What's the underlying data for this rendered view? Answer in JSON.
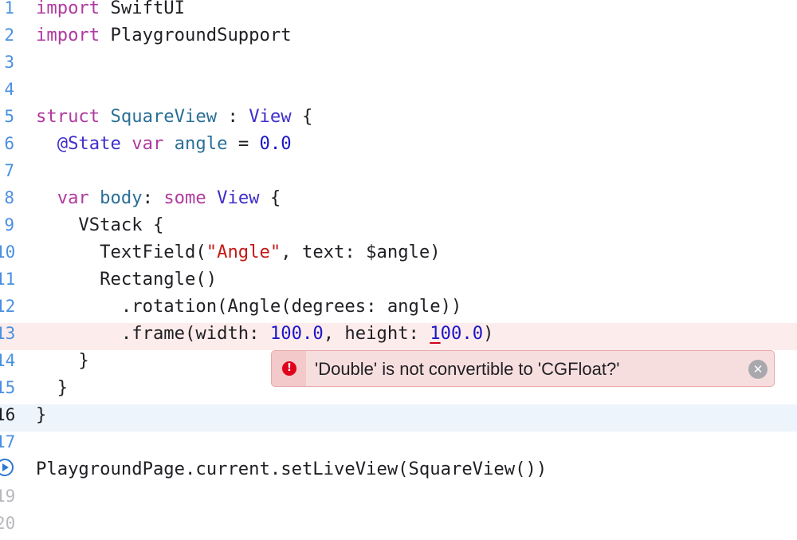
{
  "editor": {
    "lines": [
      {
        "n": "1",
        "parts": [
          {
            "t": "import",
            "c": "kw"
          },
          {
            "t": " SwiftUI",
            "c": ""
          }
        ]
      },
      {
        "n": "2",
        "parts": [
          {
            "t": "import",
            "c": "kw"
          },
          {
            "t": " PlaygroundSupport",
            "c": ""
          }
        ]
      },
      {
        "n": "3",
        "parts": []
      },
      {
        "n": "4",
        "parts": []
      },
      {
        "n": "5",
        "parts": [
          {
            "t": "struct",
            "c": "kw"
          },
          {
            "t": " ",
            "c": ""
          },
          {
            "t": "SquareView",
            "c": "pty"
          },
          {
            "t": " : ",
            "c": ""
          },
          {
            "t": "View",
            "c": "ty"
          },
          {
            "t": " {",
            "c": ""
          }
        ]
      },
      {
        "n": "6",
        "parts": [
          {
            "t": "  @State",
            "c": "ty"
          },
          {
            "t": " ",
            "c": ""
          },
          {
            "t": "var",
            "c": "kw"
          },
          {
            "t": " ",
            "c": ""
          },
          {
            "t": "angle",
            "c": "pty"
          },
          {
            "t": " = ",
            "c": ""
          },
          {
            "t": "0.0",
            "c": "num"
          }
        ]
      },
      {
        "n": "7",
        "parts": []
      },
      {
        "n": "8",
        "parts": [
          {
            "t": "  ",
            "c": ""
          },
          {
            "t": "var",
            "c": "kw"
          },
          {
            "t": " ",
            "c": ""
          },
          {
            "t": "body",
            "c": "pty"
          },
          {
            "t": ": ",
            "c": ""
          },
          {
            "t": "some",
            "c": "kw"
          },
          {
            "t": " ",
            "c": ""
          },
          {
            "t": "View",
            "c": "ty"
          },
          {
            "t": " {",
            "c": ""
          }
        ]
      },
      {
        "n": "9",
        "parts": [
          {
            "t": "    VStack {",
            "c": ""
          }
        ]
      },
      {
        "n": "10",
        "parts": [
          {
            "t": "      TextField(",
            "c": ""
          },
          {
            "t": "\"Angle\"",
            "c": "str"
          },
          {
            "t": ", text: $angle)",
            "c": ""
          }
        ]
      },
      {
        "n": "11",
        "parts": [
          {
            "t": "      Rectangle()",
            "c": ""
          }
        ]
      },
      {
        "n": "12",
        "parts": [
          {
            "t": "        .rotation(Angle(degrees: angle))",
            "c": ""
          }
        ]
      },
      {
        "n": "13",
        "parts": [
          {
            "t": "        .frame(width: ",
            "c": ""
          },
          {
            "t": "100.0",
            "c": "num"
          },
          {
            "t": ", height: ",
            "c": ""
          },
          {
            "t": "1",
            "c": "num squiggle"
          },
          {
            "t": "00.0",
            "c": "num"
          },
          {
            "t": ")",
            "c": ""
          }
        ]
      },
      {
        "n": "14",
        "parts": [
          {
            "t": "    }",
            "c": ""
          }
        ]
      },
      {
        "n": "15",
        "parts": [
          {
            "t": "  }",
            "c": ""
          }
        ]
      },
      {
        "n": "16",
        "parts": [
          {
            "t": "}",
            "c": ""
          }
        ]
      },
      {
        "n": "17",
        "parts": []
      },
      {
        "n": "18",
        "parts": [
          {
            "t": "PlaygroundPage.current.setLiveView(SquareView())",
            "c": ""
          }
        ]
      },
      {
        "n": "19",
        "parts": []
      },
      {
        "n": "20",
        "parts": []
      }
    ],
    "error_line_index": 12,
    "current_line_index": 15,
    "run_line_index": 17
  },
  "error": {
    "icon": "!",
    "message": "'Double' is not convertible to 'CGFloat?'",
    "close": "✕"
  }
}
